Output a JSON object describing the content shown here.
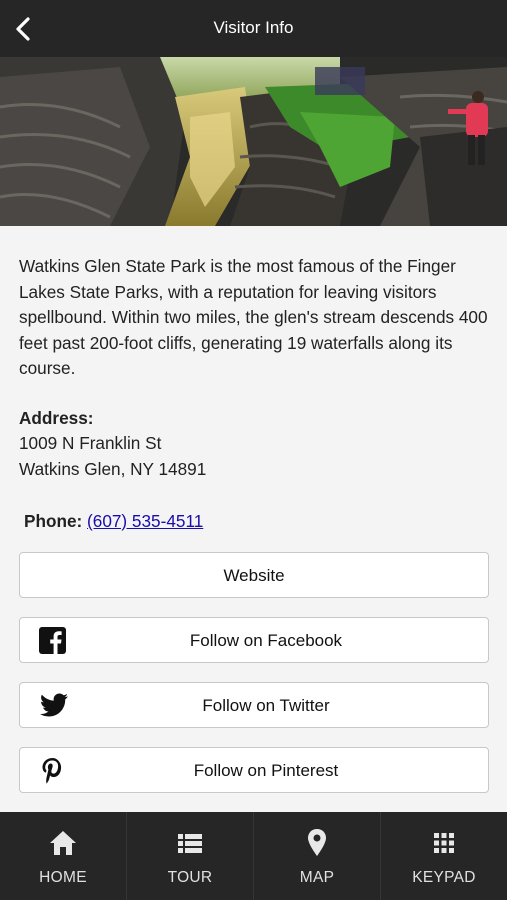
{
  "header": {
    "title": "Visitor Info",
    "back_icon": "chevron-left-icon"
  },
  "hero": {
    "image": "gorge-waterfall-photo"
  },
  "info": {
    "description": "Watkins Glen State Park is the most famous of the Finger Lakes State Parks, with a reputation for leaving visitors spellbound. Within two miles, the glen's stream descends 400 feet past 200-foot cliffs, generating 19 waterfalls along its course.",
    "address_label": "Address:",
    "address_line1": "1009 N Franklin St",
    "address_line2": "Watkins Glen, NY 14891",
    "phone_label": "Phone:",
    "phone_number": "(607) 535-4511"
  },
  "buttons": {
    "website": "Website",
    "facebook": "Follow on Facebook",
    "twitter": "Follow on Twitter",
    "pinterest": "Follow on Pinterest"
  },
  "tabs": [
    {
      "label": "HOME",
      "icon": "home-icon"
    },
    {
      "label": "TOUR",
      "icon": "list-icon"
    },
    {
      "label": "MAP",
      "icon": "map-pin-icon"
    },
    {
      "label": "KEYPAD",
      "icon": "keypad-icon"
    }
  ],
  "colors": {
    "bar": "#262626",
    "background": "#f4f4f4",
    "link": "#1a0dab"
  }
}
